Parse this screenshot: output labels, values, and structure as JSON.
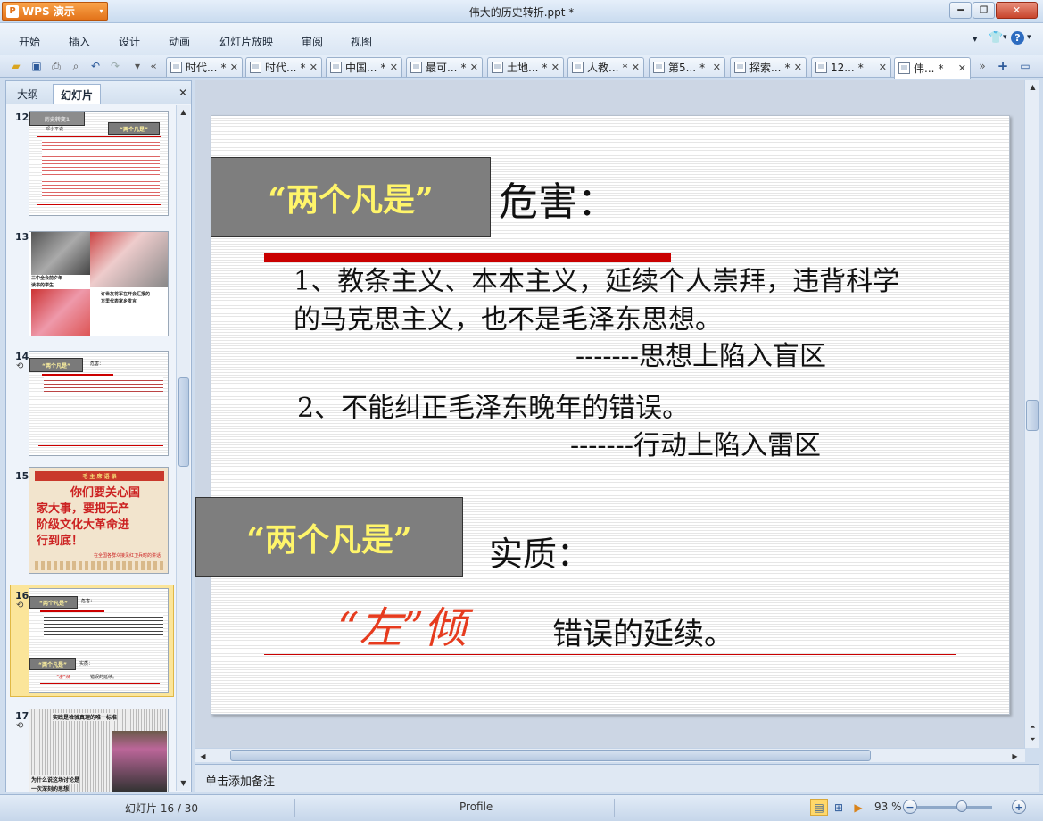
{
  "app": {
    "name": "WPS 演示",
    "logo_char": "P",
    "menu_arrow": "▾"
  },
  "window": {
    "title": "伟大的历史转折.ppt *",
    "min": "━",
    "max": "❐",
    "close": "✕"
  },
  "menu": {
    "items": [
      "开始",
      "插入",
      "设计",
      "动画",
      "幻灯片放映",
      "审阅",
      "视图"
    ],
    "right": {
      "collapse": "▾",
      "skin": "👕",
      "skin_arrow": "▾",
      "help": "?",
      "help_arrow": "▾"
    }
  },
  "toolbar": {
    "icons": [
      "open-folder",
      "save",
      "print",
      "print-preview",
      "undo",
      "redo",
      "more",
      "tab-scroll-left"
    ],
    "tabs": [
      {
        "label": "时代...",
        "mark": "*"
      },
      {
        "label": "时代...",
        "mark": "*"
      },
      {
        "label": "中国...",
        "mark": "*"
      },
      {
        "label": "最可...",
        "mark": "*"
      },
      {
        "label": "土地...",
        "mark": "*"
      },
      {
        "label": "人教...",
        "mark": "*"
      },
      {
        "label": "第5...",
        "mark": "*"
      },
      {
        "label": "探索...",
        "mark": "*"
      },
      {
        "label": "12...",
        "mark": "*"
      },
      {
        "label": "伟...",
        "mark": "*"
      }
    ],
    "close_glyph": "✕",
    "tabs_right": {
      "scroll": "»",
      "new_tab": "+",
      "layout": "▭"
    }
  },
  "side_panel": {
    "tabs": [
      "大纲",
      "幻灯片"
    ],
    "close": "✕",
    "thumbnails": [
      {
        "num": "12",
        "header": "历史转变1",
        "speaker": "邓小平说",
        "title": "“两个凡是”"
      },
      {
        "num": "13",
        "caption1": "三中全会前夕年",
        "caption1b": "读书的学生",
        "caption2": "许世友将军在开会汇报的",
        "caption2b": "万里代表家乡发言"
      },
      {
        "num": "14",
        "anim": "⟲",
        "gbox": "“两个凡是”",
        "after": "危害："
      },
      {
        "num": "15",
        "poster_top": "毛  主  席  语  录",
        "poster_l1": "你们要关心国",
        "poster_l2": "家大事，要把无产",
        "poster_l3": "阶级文化大革命进",
        "poster_l4": "行到底！",
        "poster_foot": "在全国各群众接见红卫兵时的讲话"
      },
      {
        "num": "16",
        "anim": "⟲",
        "gbox1": "“两个凡是”",
        "after1": "危害：",
        "gbox2": "“两个凡是”",
        "after2": "实质：",
        "left_lean": "“左”倾",
        "left_rest": "错误的延续。"
      },
      {
        "num": "17",
        "anim": "⟲",
        "headline": "实践是检验真理的唯一标准",
        "caption": "为什么说这场讨论是",
        "caption2": "一次深刻的思想"
      }
    ]
  },
  "slide": {
    "title_box": "“两个凡是”",
    "title_after": "危害：",
    "point1_line1": "1、教条主义、本本主义，延续个人崇拜，违背科学",
    "point1_line2": "的马克思主义，也不是毛泽东思想。",
    "point1_tail": "-------思想上陷入盲区",
    "point2": "2、不能纠正毛泽东晚年的错误。",
    "point2_tail": "-------行动上陷入雷区",
    "essence_box": "“两个凡是”",
    "essence_after": "实质：",
    "left_lean": "“左”倾",
    "error_cont": "错误的延续。"
  },
  "notes": {
    "placeholder": "单击添加备注"
  },
  "status": {
    "slide_info": "幻灯片 16 / 30",
    "theme": "Profile",
    "zoom": "93 %",
    "zoom_minus": "−",
    "zoom_plus": "+"
  },
  "colors": {
    "accent_red": "#cc0000",
    "box_gray": "#7e7e7e",
    "box_text": "#fff56a",
    "wps_orange": "#e3731a"
  }
}
